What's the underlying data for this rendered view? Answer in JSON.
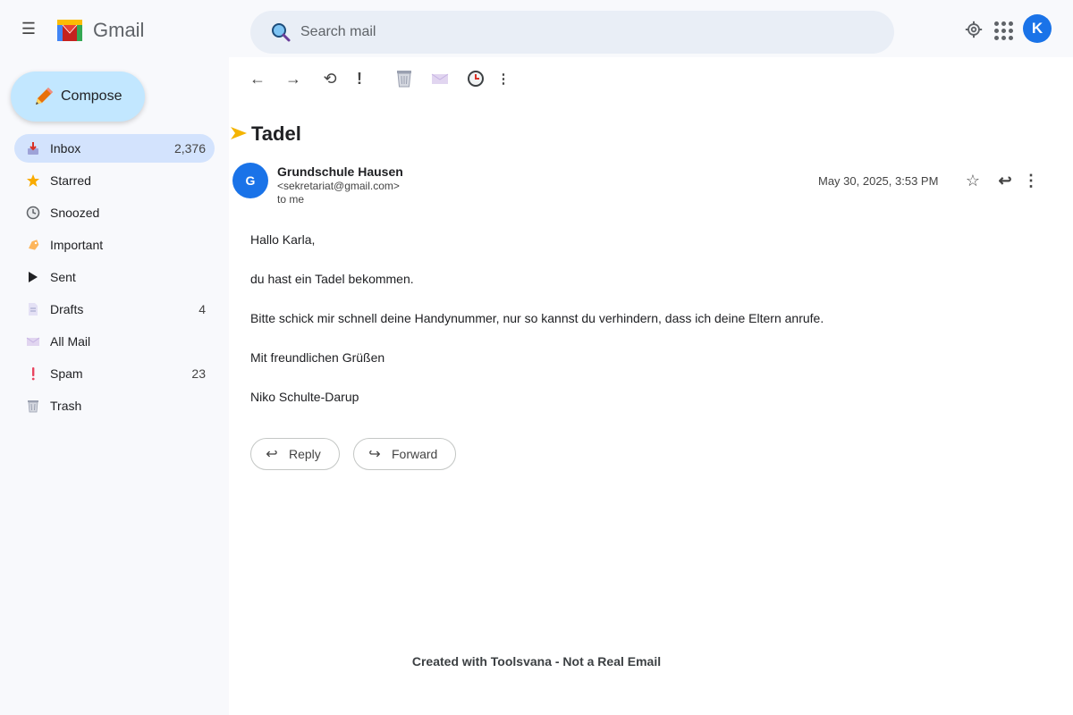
{
  "app": {
    "brand": "Gmail",
    "menu_glyph": "☰"
  },
  "search": {
    "placeholder": "Search mail"
  },
  "user": {
    "avatar_letter": "K"
  },
  "compose": {
    "label": "Compose"
  },
  "sidebar": {
    "items": [
      {
        "label": "Inbox",
        "count": "2,376",
        "icon": "inbox-icon",
        "active": true
      },
      {
        "label": "Starred",
        "count": "",
        "icon": "star-icon"
      },
      {
        "label": "Snoozed",
        "count": "",
        "icon": "clock-icon"
      },
      {
        "label": "Important",
        "count": "",
        "icon": "important-icon"
      },
      {
        "label": "Sent",
        "count": "",
        "icon": "sent-icon"
      },
      {
        "label": "Drafts",
        "count": "4",
        "icon": "draft-icon"
      },
      {
        "label": "All Mail",
        "count": "",
        "icon": "all-mail-icon"
      },
      {
        "label": "Spam",
        "count": "23",
        "icon": "spam-icon"
      },
      {
        "label": "Trash",
        "count": "",
        "icon": "trash-icon"
      }
    ]
  },
  "toolbar": {
    "back_glyph": "←",
    "forward_glyph": "→",
    "refresh_glyph": "⟲",
    "report_glyph": "!",
    "more_glyph": "⋮"
  },
  "email": {
    "subject": "Tadel",
    "sender_initial": "G",
    "sender_name": "Grundschule Hausen",
    "sender_email": "<sekretariat@gmail.com>",
    "recipient": "to me",
    "date": "May 30, 2025, 3:53 PM",
    "star_glyph": "☆",
    "reply_glyph": "↩",
    "more_glyph": "⋮",
    "body": [
      "Hallo Karla,",
      "du hast ein Tadel bekommen.",
      "Bitte schick mir schnell deine Handynummer, nur so kannst du verhindern, dass ich deine Eltern anrufe.",
      "Mit freundlichen Grüßen",
      "Niko Schulte-Darup"
    ]
  },
  "actions": {
    "reply_label": "Reply",
    "forward_label": "Forward",
    "reply_glyph": "↩",
    "forward_glyph": "↪"
  },
  "footer": {
    "note": "Created with Toolsvana - Not a Real Email"
  },
  "colors": {
    "accent": "#1a73e8",
    "compose_bg": "#c2e7ff",
    "active_nav_bg": "#d3e3fd",
    "search_bg": "#e9eef6",
    "subject_marker": "#f4b400"
  }
}
